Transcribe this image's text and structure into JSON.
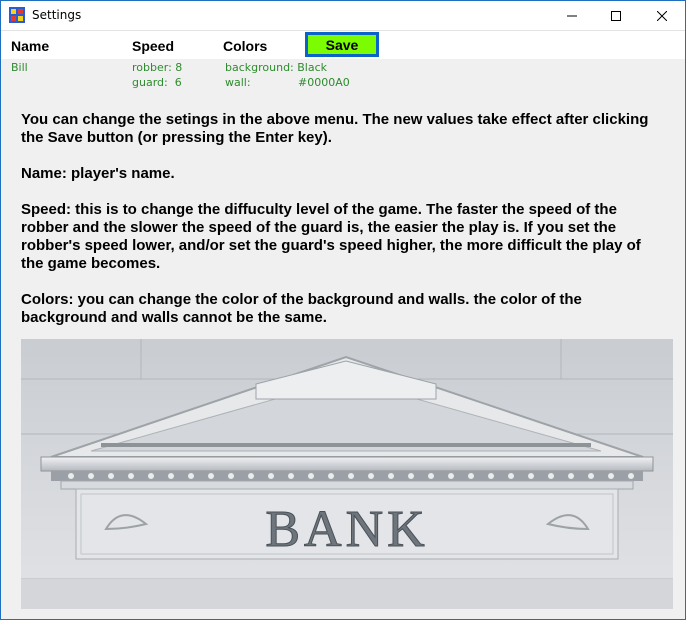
{
  "window": {
    "title": "Settings"
  },
  "menu": {
    "name_label": "Name",
    "speed_label": "Speed",
    "colors_label": "Colors",
    "save_label": "Save"
  },
  "values": {
    "name": "Bill",
    "robber_speed": "robber: 8",
    "guard_speed": "guard:  6",
    "background_color": "background: Black",
    "wall_label": "wall:",
    "wall_color": "#0000A0"
  },
  "help": {
    "p1": "You can change the setings in the above menu. The new values take effect after clicking the Save button (or pressing the Enter key).",
    "p2": "Name: player's name.",
    "p3": "Speed: this is to change the diffuculty level of the game. The faster the speed of the robber and the slower the speed of the guard is, the easier the play is. If you set the robber's speed lower, and/or set the guard's speed higher, the more difficult the play of the game becomes.",
    "p4": "Colors: you can change the color of the background and walls. the color of the background and walls cannot be the same."
  },
  "image": {
    "sign_text": "BANK"
  },
  "colors": {
    "save_button": "#7cfc00",
    "value_text": "#2e8b2e",
    "focus_border": "#0a63c9"
  },
  "icons": [
    "app-icon",
    "minimize-icon",
    "maximize-icon",
    "close-icon"
  ]
}
